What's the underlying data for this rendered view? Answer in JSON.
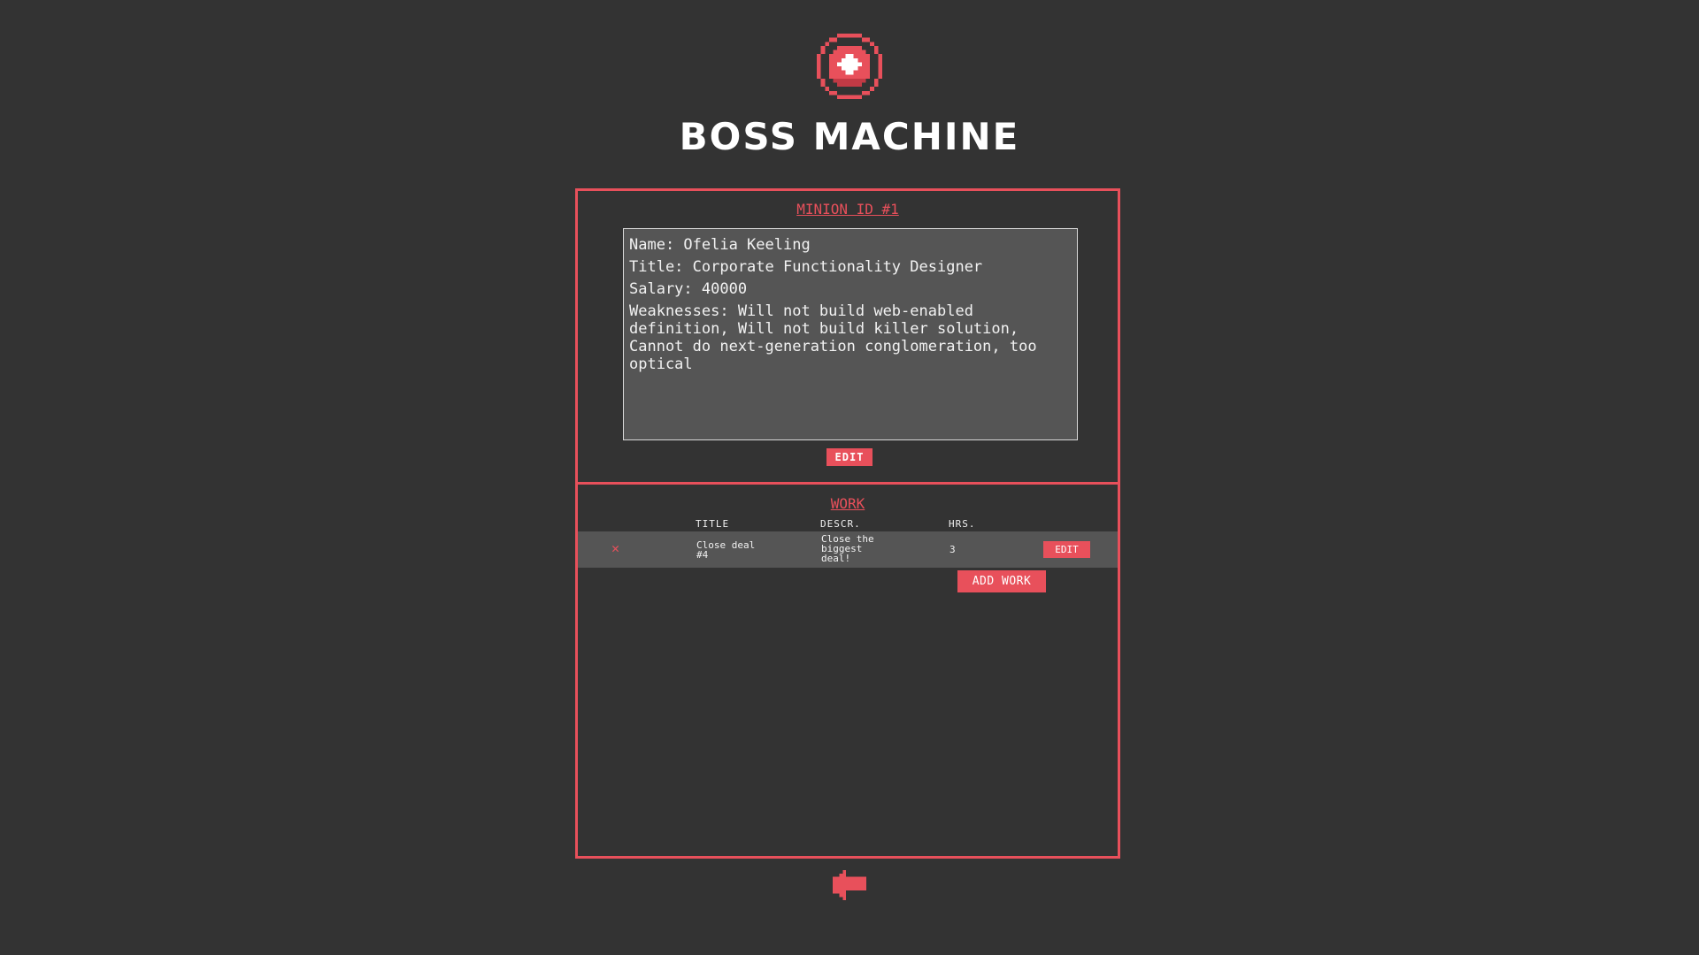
{
  "app": {
    "title": "BOSS MACHINE",
    "accent_color": "#e8505b",
    "background_color": "#333333"
  },
  "minion": {
    "heading": "MINION ID #1",
    "fields": [
      "Name: Ofelia Keeling",
      "Title: Corporate Functionality Designer",
      "Salary: 40000",
      "Weaknesses: Will not build web-enabled definition, Will not build killer solution, Cannot do next-generation conglomeration, too optical"
    ],
    "edit_label": "EDIT"
  },
  "work": {
    "heading": "WORK",
    "columns": [
      "TITLE",
      "DESCR.",
      "HRS."
    ],
    "rows": [
      {
        "title": "Close deal #4",
        "description": "Close the biggest deal!",
        "hours": "3",
        "edit_label": "EDIT",
        "delete_symbol": "✕"
      }
    ],
    "add_label": "ADD WORK"
  },
  "icons": {
    "logo": "target-icon",
    "back": "back-arrow-icon"
  }
}
